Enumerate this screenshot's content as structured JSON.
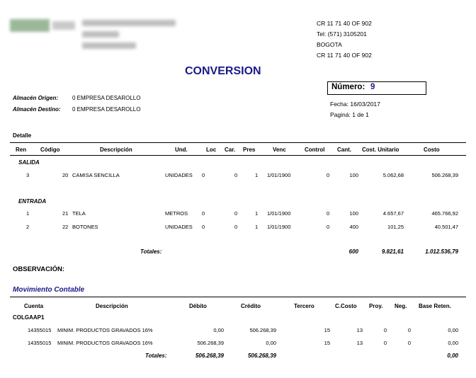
{
  "company": {
    "logo": "company-logo",
    "right_lines": [
      "CR 11 71 40 OF 902",
      "Tel: (571) 3105201",
      "BOGOTA",
      "CR 11 71 40 OF 902"
    ]
  },
  "doc": {
    "title": "CONVERSION",
    "numero_label": "Número:",
    "numero_value": "9",
    "fecha": "Fecha:  16/03/2017",
    "pagina": "Paginá: 1 de 1"
  },
  "almacen": {
    "origen_label": "Almacén Origen:",
    "origen_value": "0 EMPRESA DESAROLLO",
    "destino_label": "Almacén Destino:",
    "destino_value": "0 EMPRESA DESAROLLO"
  },
  "detalle": {
    "label": "Detalle",
    "headers": [
      "Ren",
      "Código",
      "Descripción",
      "Und.",
      "Loc",
      "Car.",
      "Pres",
      "Venc",
      "Control",
      "Cant.",
      "Cost. Unitario",
      "Costo"
    ],
    "sections": [
      {
        "name": "SALIDA",
        "rows": [
          [
            "3",
            "20",
            "CAMISA SENCILLA",
            "UNIDADES",
            "0",
            "0",
            "1",
            "1/01/1900",
            "0",
            "100",
            "5.062,68",
            "506.268,39"
          ]
        ]
      },
      {
        "name": "ENTRADA",
        "rows": [
          [
            "1",
            "21",
            "TELA",
            "METROS",
            "0",
            "0",
            "1",
            "1/01/1900",
            "0",
            "100",
            "4.657,67",
            "465.766,92"
          ],
          [
            "2",
            "22",
            "BOTONES",
            "UNIDADES",
            "0",
            "0",
            "1",
            "1/01/1900",
            "0",
            "400",
            "101,25",
            "40.501,47"
          ]
        ]
      }
    ],
    "totales_label": "Totales:",
    "totales": {
      "cant": "600",
      "unit": "9.821,61",
      "costo": "1.012.536,79"
    }
  },
  "observacion": "OBSERVACIÓN:",
  "movimiento": {
    "title": "Movimiento Contable",
    "headers": [
      "Cuenta",
      "Descripción",
      "Débito",
      "Crédito",
      "Tercero",
      "C.Costo",
      "Proy.",
      "Neg.",
      "Base Reten."
    ],
    "group": "COLGAAP1",
    "rows": [
      [
        "14355015",
        "MINIM. PRODUCTOS GRAVADOS 16%",
        "0,00",
        "506.268,39",
        "15",
        "13",
        "0",
        "0",
        "0,00"
      ],
      [
        "14355015",
        "MINIM. PRODUCTOS GRAVADOS 16%",
        "506.268,39",
        "0,00",
        "15",
        "13",
        "0",
        "0",
        "0,00"
      ]
    ],
    "totales_label": "Totales:",
    "totales": {
      "debito": "506.268,39",
      "credito": "506.268,39",
      "base": "0,00"
    }
  }
}
